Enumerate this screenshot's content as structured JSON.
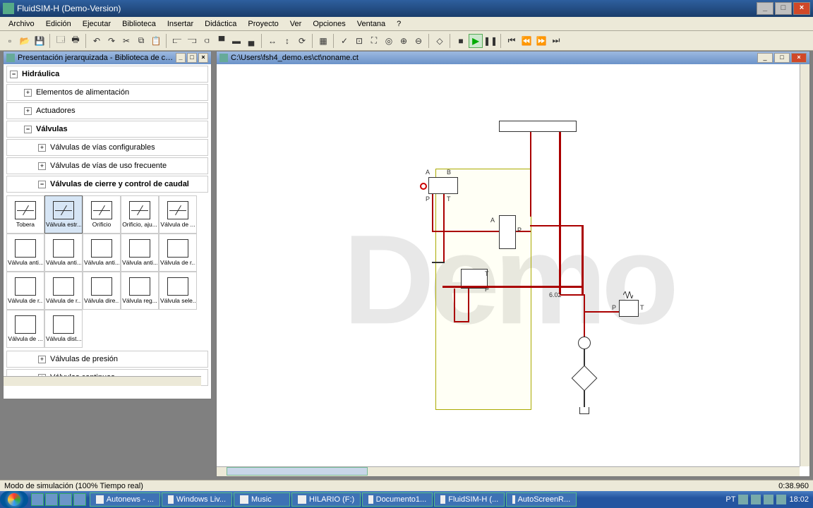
{
  "app": {
    "title": "FluidSIM-H (Demo-Version)"
  },
  "menu": [
    "Archivo",
    "Edición",
    "Ejecutar",
    "Biblioteca",
    "Insertar",
    "Didáctica",
    "Proyecto",
    "Ver",
    "Opciones",
    "Ventana",
    "?"
  ],
  "panels": {
    "library_title": "Presentación jerarquizada - Biblioteca de co...",
    "canvas_title": "C:\\Users\\fsh4_demo.es\\ct\\noname.ct"
  },
  "tree": {
    "root": "Hidráulica",
    "lvl1": [
      "Elementos de alimentación",
      "Actuadores",
      "Válvulas"
    ],
    "lvl2a": [
      "Válvulas de vías configurables",
      "Válvulas de vías de uso frecuente",
      "Válvulas de cierre y control de caudal"
    ],
    "lvl2b": [
      "Válvulas de presión",
      "Válvulas continuas"
    ]
  },
  "components": [
    {
      "label": "Tobera"
    },
    {
      "label": "Válvula estr..."
    },
    {
      "label": "Orificio"
    },
    {
      "label": "Orificio, aju..."
    },
    {
      "label": "Válvula de ..."
    },
    {
      "label": "Válvula anti..."
    },
    {
      "label": "Válvula anti..."
    },
    {
      "label": "Válvula anti..."
    },
    {
      "label": "Válvula anti..."
    },
    {
      "label": "Válvula de r..."
    },
    {
      "label": "Válvula de r..."
    },
    {
      "label": "Válvula de r..."
    },
    {
      "label": "Válvula dire..."
    },
    {
      "label": "Válvula reg..."
    },
    {
      "label": "Válvula sele..."
    },
    {
      "label": "Válvula de ..."
    },
    {
      "label": "Válvula dist..."
    }
  ],
  "circuit": {
    "port_A": "A",
    "port_B": "B",
    "port_P": "P",
    "port_T": "T",
    "value": "6.02"
  },
  "watermark": "Demo",
  "status": {
    "left": "Modo de simulación (100% Tiempo real)",
    "right": "0:38.960"
  },
  "taskbar": {
    "tasks": [
      "Autonews - ...",
      "Windows Liv...",
      "Music",
      "HILARIO (F:)",
      "Documento1...",
      "FluidSIM-H (...",
      "AutoScreenR..."
    ],
    "lang": "PT",
    "clock": "18:02"
  }
}
